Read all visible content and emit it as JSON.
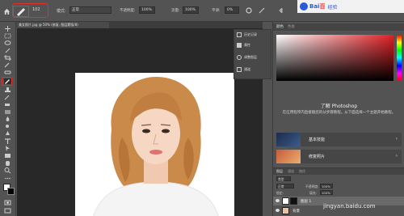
{
  "options_bar": {
    "brush_size": "102",
    "mode_label": "模式:",
    "mode_value": "正常",
    "opacity_label": "不透明度:",
    "opacity_value": "100%",
    "flow_label": "流量:",
    "flow_value": "100%",
    "smoothing_label": "平滑:",
    "smoothing_value": "0%"
  },
  "watermark_logo": {
    "brand": "Bai",
    "brand_accent": "百",
    "suffix": "经验"
  },
  "document_tab": {
    "title": "美女照片.jpg @ 50% (修复, 图层蒙版/8)"
  },
  "mini_panel": {
    "items": [
      "历史记录",
      "属性",
      "调整图层",
      "通道"
    ]
  },
  "color_panel": {
    "tabs": [
      "颜色",
      "色板"
    ]
  },
  "learn_panel": {
    "title": "了解 Photoshop",
    "description": "在应用程序内直接随您的分步骤教程。从下面选择一个主题开始教程。",
    "cards": [
      {
        "label": "基本技能"
      },
      {
        "label": "修复照片"
      }
    ]
  },
  "layers_panel": {
    "tabs": [
      "图层",
      "通道",
      "路径"
    ],
    "kind_label": "类型",
    "blend": "正常",
    "opacity_label": "不透明度:",
    "opacity": "100%",
    "fill_label": "填充:",
    "fill": "100%",
    "lock_label": "锁定:",
    "layers": [
      {
        "name": "图层 1",
        "selected": true
      },
      {
        "name": "背景",
        "selected": false
      }
    ]
  },
  "bottom_watermark": "jingyan.baidu.com",
  "colors": {
    "highlight_red": "#e0302a",
    "baidu_blue": "#2a5bd7"
  }
}
